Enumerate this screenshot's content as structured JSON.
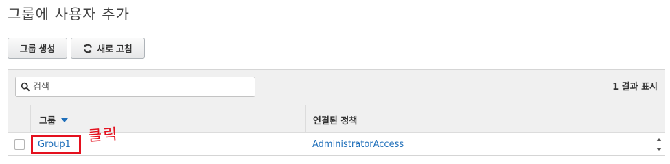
{
  "page": {
    "title": "그룹에 사용자 추가"
  },
  "toolbar": {
    "create_group_label": "그룹 생성",
    "refresh_label": "새로 고침"
  },
  "search": {
    "placeholder": "검색",
    "value": ""
  },
  "results": {
    "count_label": "1 결과 표시"
  },
  "table": {
    "columns": [
      "그룹",
      "연결된 정책"
    ],
    "sort": {
      "column": "그룹",
      "direction": "descending"
    },
    "rows": [
      {
        "selected": false,
        "group": "Group1",
        "policy": "AdministratorAccess"
      }
    ]
  },
  "annotation": {
    "text": "클릭",
    "color": "#e4101e"
  },
  "colors": {
    "link": "#1f6fba",
    "header_bg": "#f0f0f0",
    "border": "#d5d5d5"
  }
}
